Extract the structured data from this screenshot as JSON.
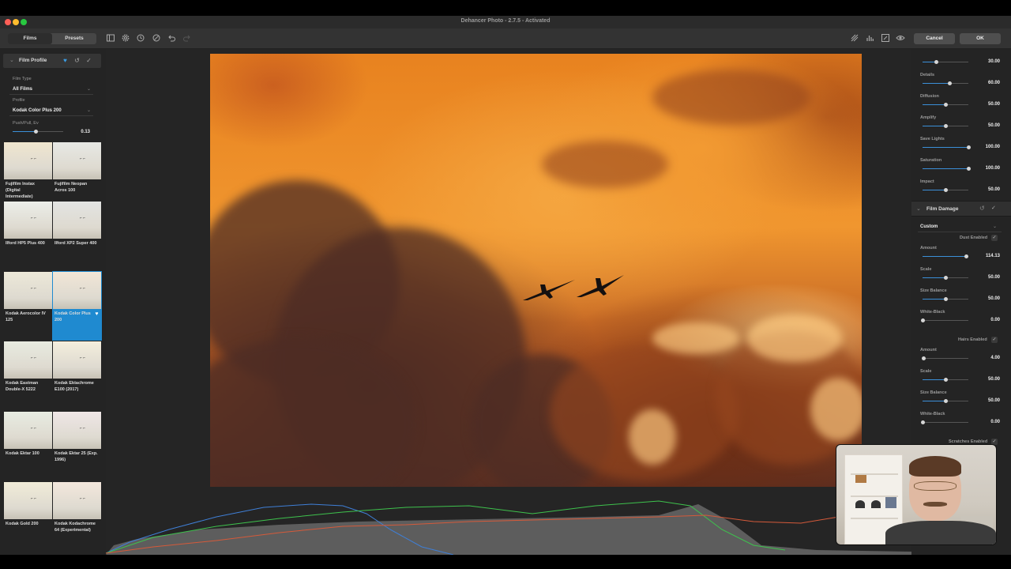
{
  "window": {
    "title": "Dehancer Photo - 2.7.5 - Activated"
  },
  "toolbar": {
    "tabs": [
      {
        "label": "Films",
        "active": true
      },
      {
        "label": "Presets",
        "active": false
      }
    ],
    "cancel_label": "Cancel",
    "ok_label": "OK"
  },
  "film_profile": {
    "title": "Film Profile",
    "film_type_label": "Film Type",
    "film_type_value": "All Films",
    "profile_label": "Profile",
    "profile_value": "Kodak Color Plus 200",
    "push_pull_label": "Push/Pull, Ev",
    "push_pull_value": "0.13",
    "push_pull_fraction": 0.46
  },
  "films": [
    {
      "line1": "Fujifilm Instax",
      "line2": "(Digital",
      "line3": "Intermediate)"
    },
    {
      "line1": "Fujifilm Neopan",
      "line2": "Acros 100",
      "line3": ""
    },
    {
      "line1": "Ilford HP5 Plus 400",
      "line2": "",
      "line3": ""
    },
    {
      "line1": "Ilford XP2 Super 400",
      "line2": "",
      "line3": ""
    },
    {
      "line1": "Kodak Aerocolor IV",
      "line2": "125",
      "line3": ""
    },
    {
      "line1": "Kodak Color Plus",
      "line2": "200",
      "line3": "",
      "selected": true
    },
    {
      "line1": "Kodak Eastman",
      "line2": "Double-X 5222",
      "line3": ""
    },
    {
      "line1": "Kodak Ektachrome",
      "line2": "E100 (2017)",
      "line3": ""
    },
    {
      "line1": "Kodak Ektar 100",
      "line2": "",
      "line3": ""
    },
    {
      "line1": "Kodak Ektar 25 (Exp.",
      "line2": "1996)",
      "line3": ""
    },
    {
      "line1": "Kodak Gold 200",
      "line2": "",
      "line3": ""
    },
    {
      "line1": "Kodak Kodachrome",
      "line2": "64 (Experimental)",
      "line3": ""
    }
  ],
  "right_panel": {
    "top_value": "30.00",
    "sliders": [
      {
        "label": "Details",
        "value": "60.00",
        "fraction": 0.6
      },
      {
        "label": "Diffusion",
        "value": "50.00",
        "fraction": 0.5
      },
      {
        "label": "Amplify",
        "value": "50.00",
        "fraction": 0.5
      },
      {
        "label": "Save Lights",
        "value": "100.00",
        "fraction": 1.0
      },
      {
        "label": "Saturation",
        "value": "100.00",
        "fraction": 1.0
      },
      {
        "label": "Impact",
        "value": "50.00",
        "fraction": 0.5
      }
    ],
    "film_damage": {
      "title": "Film Damage",
      "preset": "Custom",
      "dust_label": "Dust Enabled",
      "dust": [
        {
          "label": "Amount",
          "value": "114.13",
          "fraction": 0.95
        },
        {
          "label": "Scale",
          "value": "50.00",
          "fraction": 0.5
        },
        {
          "label": "Size Balance",
          "value": "50.00",
          "fraction": 0.5
        },
        {
          "label": "White-Black",
          "value": "0.00",
          "fraction": 0.0
        }
      ],
      "hairs_label": "Hairs Enabled",
      "hairs": [
        {
          "label": "Amount",
          "value": "4.00",
          "fraction": 0.02
        },
        {
          "label": "Scale",
          "value": "50.00",
          "fraction": 0.5
        },
        {
          "label": "Size Balance",
          "value": "50.00",
          "fraction": 0.5
        },
        {
          "label": "White-Black",
          "value": "0.00",
          "fraction": 0.0
        }
      ],
      "scratches_label": "Scratches Enabled"
    }
  },
  "colors": {
    "accent": "#1f8ad0",
    "slider_fill": "#3b8fd8"
  }
}
